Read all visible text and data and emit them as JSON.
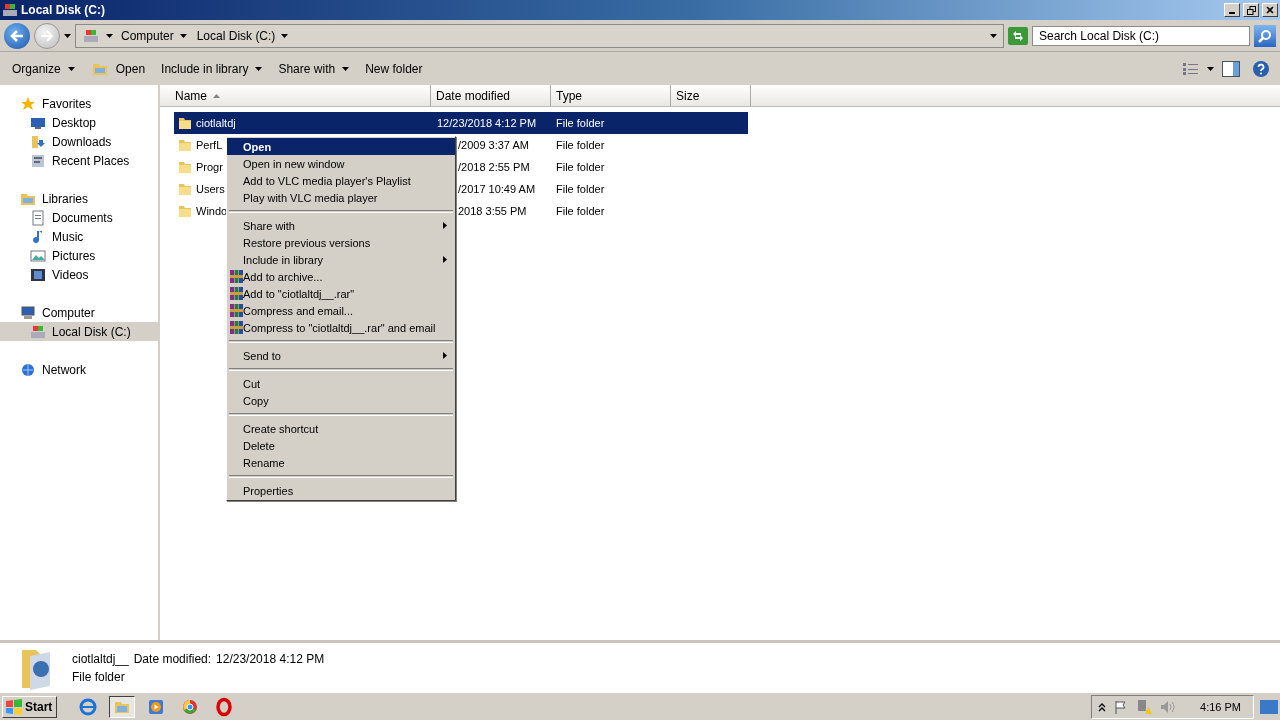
{
  "window": {
    "title": "Local Disk (C:)"
  },
  "address_bar": {
    "crumbs": [
      "Computer",
      "Local Disk (C:)"
    ]
  },
  "search": {
    "placeholder": "Search Local Disk (C:)"
  },
  "toolbar": {
    "buttons": [
      {
        "label": "Organize",
        "kind": "menu"
      },
      {
        "label": "Open",
        "kind": "icon"
      },
      {
        "label": "Include in library",
        "kind": "menu"
      },
      {
        "label": "Share with",
        "kind": "menu"
      },
      {
        "label": "New folder",
        "kind": "plain"
      }
    ]
  },
  "sidebar": {
    "groups": [
      {
        "label": "Favorites",
        "selected": false,
        "children": [
          {
            "label": "Desktop",
            "selected": false
          },
          {
            "label": "Downloads",
            "selected": false
          },
          {
            "label": "Recent Places",
            "selected": false
          }
        ]
      },
      {
        "label": "Libraries",
        "selected": false,
        "children": [
          {
            "label": "Documents",
            "selected": false
          },
          {
            "label": "Music",
            "selected": false
          },
          {
            "label": "Pictures",
            "selected": false
          },
          {
            "label": "Videos",
            "selected": false
          }
        ]
      },
      {
        "label": "Computer",
        "selected": false,
        "children": [
          {
            "label": "Local Disk (C:)",
            "selected": true
          }
        ]
      },
      {
        "label": "Network",
        "selected": false
      }
    ]
  },
  "table": {
    "columns": [
      {
        "label": "Name",
        "sorted": true
      },
      {
        "label": "Date modified",
        "sorted": false
      },
      {
        "label": "Type",
        "sorted": false
      },
      {
        "label": "Size",
        "sorted": false
      }
    ],
    "rows": [
      {
        "name": "ciotlaltdj",
        "date_modified": "12/23/2018 4:12 PM",
        "type": "File folder",
        "selected": true,
        "covered": false
      },
      {
        "name": "PerfL",
        "date_modified": "/2009 3:37 AM",
        "type": "File folder",
        "selected": false,
        "covered": true
      },
      {
        "name": "Progr",
        "date_modified": "/2018 2:55 PM",
        "type": "File folder",
        "selected": false,
        "covered": true
      },
      {
        "name": "Users",
        "date_modified": "/2017 10:49 AM",
        "type": "File folder",
        "selected": false,
        "covered": true
      },
      {
        "name": "Windo",
        "date_modified": "2018 3:55 PM",
        "type": "File folder",
        "selected": false,
        "covered": true
      }
    ]
  },
  "context_menu": {
    "groups": [
      [
        {
          "label": "Open",
          "default": true,
          "selected": true,
          "submenu": false,
          "kind": "plain"
        },
        {
          "label": "Open in new window",
          "default": false,
          "selected": false,
          "submenu": false,
          "kind": "plain"
        },
        {
          "label": "Add to VLC media player's Playlist",
          "default": false,
          "selected": false,
          "submenu": false,
          "kind": "plain"
        },
        {
          "label": "Play with VLC media player",
          "default": false,
          "selected": false,
          "submenu": false,
          "kind": "plain"
        }
      ],
      [
        {
          "label": "Share with",
          "default": false,
          "selected": false,
          "submenu": true,
          "kind": "plain"
        },
        {
          "label": "Restore previous versions",
          "default": false,
          "selected": false,
          "submenu": false,
          "kind": "plain"
        },
        {
          "label": "Include in library",
          "default": false,
          "selected": false,
          "submenu": true,
          "kind": "plain"
        },
        {
          "label": "Add to archive...",
          "default": false,
          "selected": false,
          "submenu": false,
          "kind": "archiver"
        },
        {
          "label": "Add to \"ciotlaltdj__.rar\"",
          "default": false,
          "selected": false,
          "submenu": false,
          "kind": "archiver"
        },
        {
          "label": "Compress and email...",
          "default": false,
          "selected": false,
          "submenu": false,
          "kind": "archiver"
        },
        {
          "label": "Compress to \"ciotlaltdj__.rar\" and email",
          "default": false,
          "selected": false,
          "submenu": false,
          "kind": "archiver"
        }
      ],
      [
        {
          "label": "Send to",
          "default": false,
          "selected": false,
          "submenu": true,
          "kind": "plain"
        }
      ],
      [
        {
          "label": "Cut",
          "default": false,
          "selected": false,
          "submenu": false,
          "kind": "plain"
        },
        {
          "label": "Copy",
          "default": false,
          "selected": false,
          "submenu": false,
          "kind": "plain"
        }
      ],
      [
        {
          "label": "Create shortcut",
          "default": false,
          "selected": false,
          "submenu": false,
          "kind": "plain"
        },
        {
          "label": "Delete",
          "default": false,
          "selected": false,
          "submenu": false,
          "kind": "plain"
        },
        {
          "label": "Rename",
          "default": false,
          "selected": false,
          "submenu": false,
          "kind": "plain"
        }
      ],
      [
        {
          "label": "Properties",
          "default": false,
          "selected": false,
          "submenu": false,
          "kind": "plain"
        }
      ]
    ]
  },
  "details_pane": {
    "name": "ciotlaltdj__",
    "date_label": "Date modified:",
    "date_value": "12/23/2018 4:12 PM",
    "type": "File folder"
  },
  "taskbar": {
    "start": "Start",
    "apps": [
      {
        "selected": false
      },
      {
        "selected": true
      },
      {
        "selected": false
      },
      {
        "selected": false
      },
      {
        "selected": false
      }
    ],
    "clock": "4:16 PM"
  }
}
